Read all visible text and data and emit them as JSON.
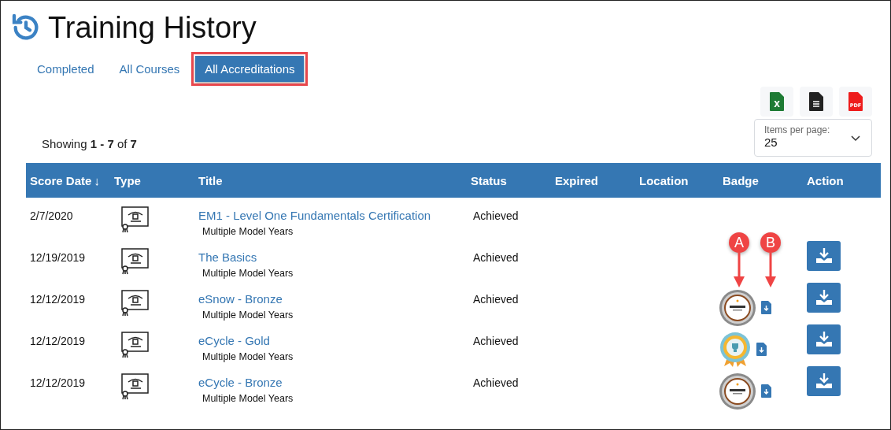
{
  "title": "Training History",
  "tabs": [
    {
      "label": "Completed",
      "selected": false
    },
    {
      "label": "All Courses",
      "selected": false
    },
    {
      "label": "All Accreditations",
      "selected": true
    }
  ],
  "exports": [
    {
      "kind": "excel",
      "label": "X"
    },
    {
      "kind": "text"
    },
    {
      "kind": "pdf",
      "label": "PDF"
    }
  ],
  "items_per_page": {
    "label": "Items per page:",
    "value": "25"
  },
  "showing": "Showing **1 - 7** of **7**",
  "table": {
    "columns": [
      {
        "label": "Score Date",
        "sort_icon": "↓"
      },
      {
        "label": "Type"
      },
      {
        "label": "Title"
      },
      {
        "label": "Status"
      },
      {
        "label": "Expired"
      },
      {
        "label": "Location"
      },
      {
        "label": "Badge"
      },
      {
        "label": "Action"
      }
    ],
    "rows": [
      {
        "date": "2/7/2020",
        "title": "EM1 - Level One Fundamentals Certification",
        "subtitle": "Multiple Model Years",
        "status": "Achieved",
        "action_download": false
      },
      {
        "date": "12/19/2019",
        "title": "The Basics",
        "subtitle": "Multiple Model Years",
        "status": "Achieved",
        "action_download": true
      },
      {
        "date": "12/12/2019",
        "title": "eSnow - Bronze",
        "subtitle": "Multiple Model Years",
        "status": "Achieved",
        "badge": {
          "kind": "bronze",
          "download": true
        },
        "action_download": true
      },
      {
        "date": "12/12/2019",
        "title": "eCycle - Gold",
        "subtitle": "Multiple Model Years",
        "status": "Achieved",
        "badge": {
          "kind": "gold",
          "download": true
        },
        "action_download": true
      },
      {
        "date": "12/12/2019",
        "title": "eCycle - Bronze",
        "subtitle": "Multiple Model Years",
        "status": "Achieved",
        "badge": {
          "kind": "bronze",
          "download": true
        },
        "action_download": true
      }
    ]
  },
  "callouts": [
    {
      "label": "A"
    },
    {
      "label": "B"
    }
  ]
}
